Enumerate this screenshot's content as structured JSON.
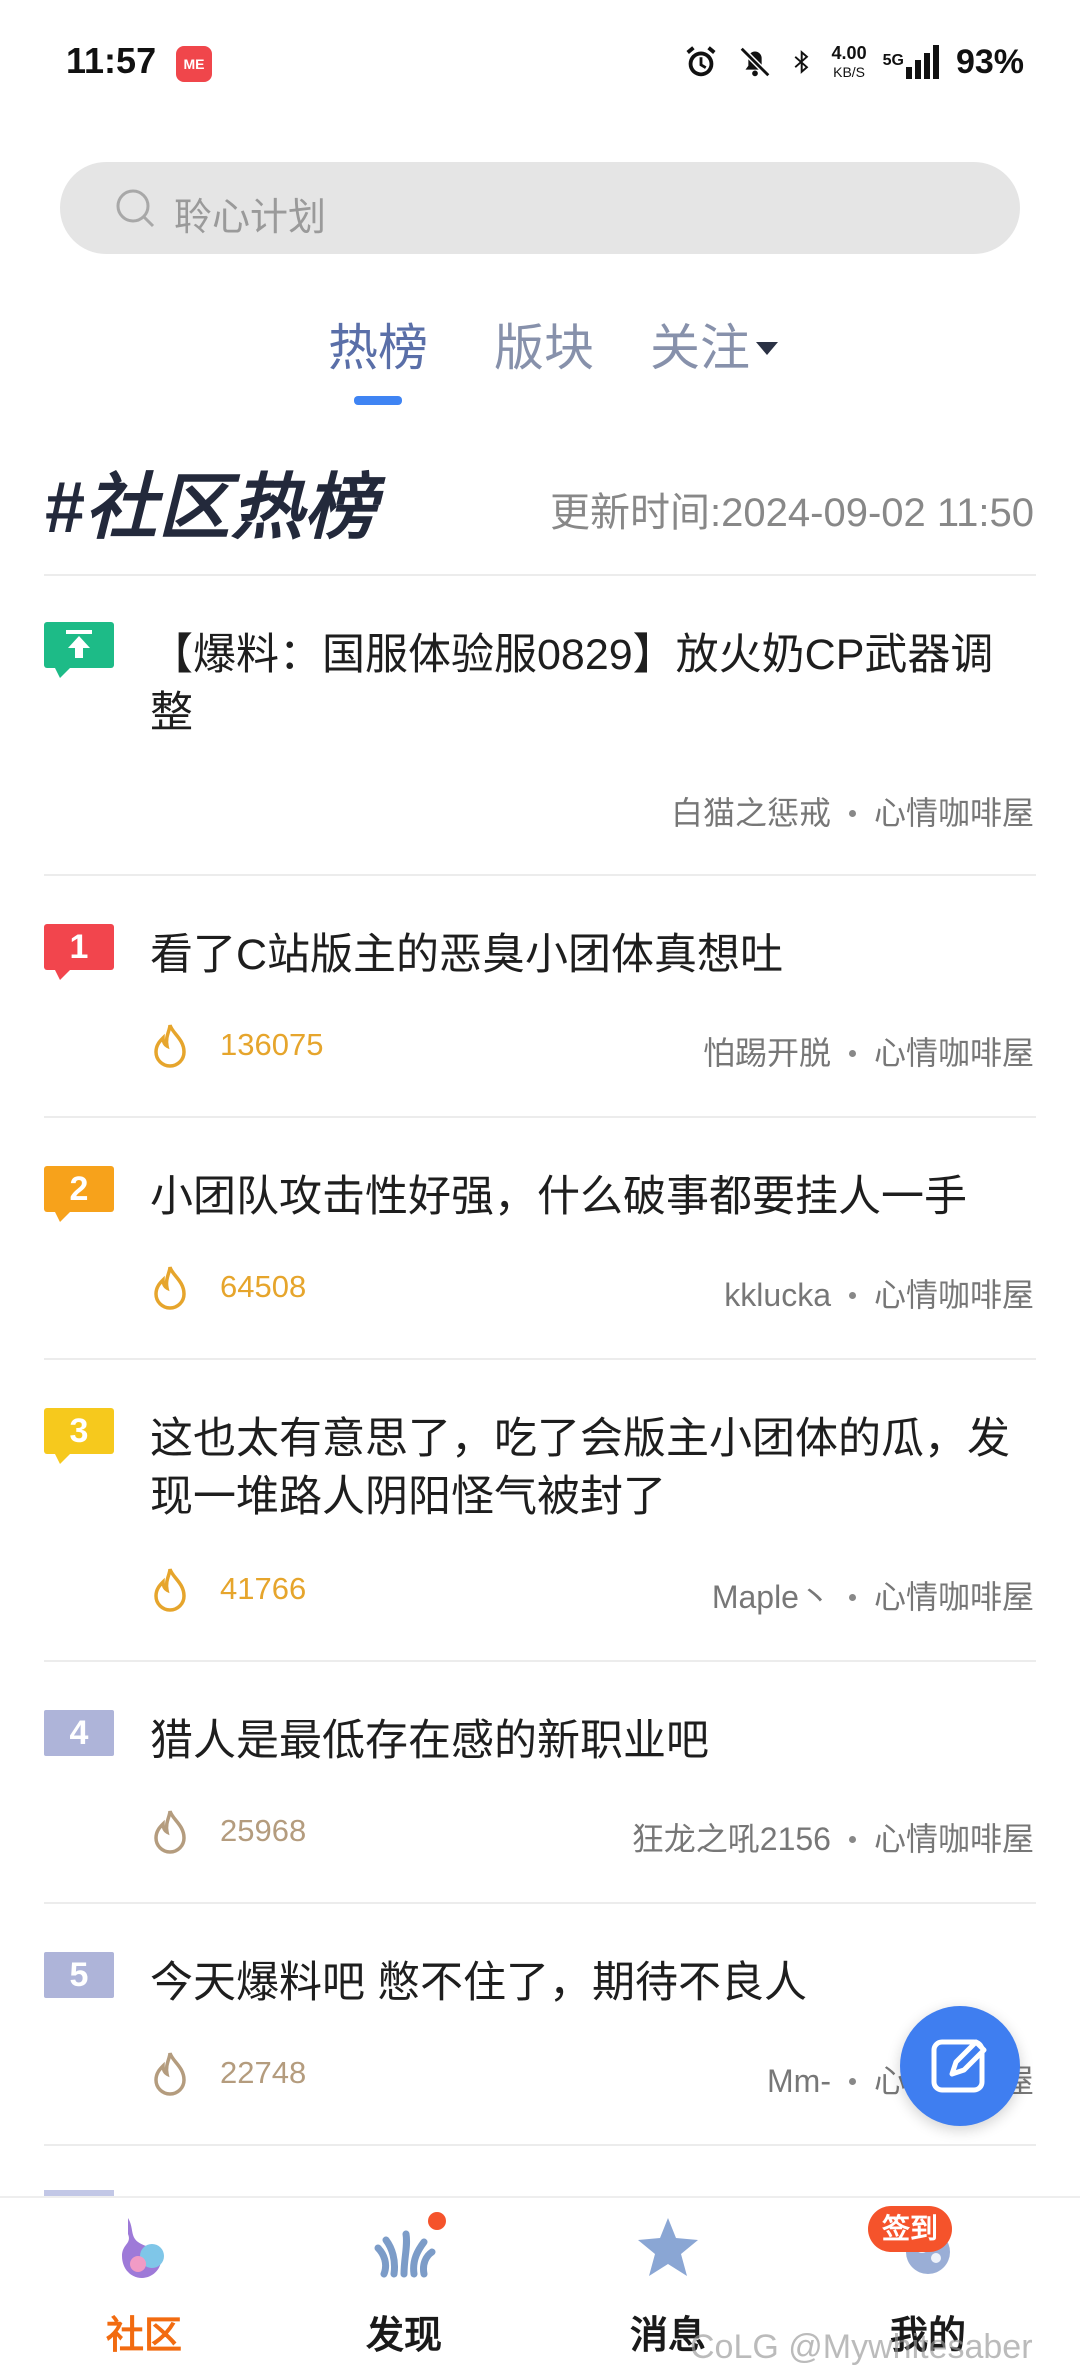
{
  "status_bar": {
    "time": "11:57",
    "app_badge": "ME",
    "net_speed_value": "4.00",
    "net_speed_unit": "KB/S",
    "network": "5G",
    "battery": "93%"
  },
  "search": {
    "placeholder": "聆心计划"
  },
  "tabs": [
    {
      "label": "热榜",
      "active": true
    },
    {
      "label": "版块",
      "active": false
    },
    {
      "label": "关注",
      "active": false
    }
  ],
  "header": {
    "title": "#社区热榜",
    "update_time": "更新时间:2024-09-02 11:50"
  },
  "posts": [
    {
      "rank_type": "pinned",
      "title": "【爆料：国服体验服0829】放火奶CP武器调整",
      "heat": "",
      "author": "白猫之惩戒",
      "board": "心情咖啡屋"
    },
    {
      "rank": "1",
      "title": "看了C站版主的恶臭小团体真想吐",
      "heat": "136075",
      "author": "怕踢开脱",
      "board": "心情咖啡屋"
    },
    {
      "rank": "2",
      "title": "小团队攻击性好强，什么破事都要挂人一手",
      "heat": "64508",
      "author": "kklucka",
      "board": "心情咖啡屋"
    },
    {
      "rank": "3",
      "title": "这也太有意思了，吃了会版主小团体的瓜，发现一堆路人阴阳怪气被封了",
      "heat": "41766",
      "author": "Maple丶",
      "board": "心情咖啡屋"
    },
    {
      "rank": "4",
      "title": "猎人是最低存在感的新职业吧",
      "heat": "25968",
      "author": "狂龙之吼2156",
      "board": "心情咖啡屋"
    },
    {
      "rank": "5",
      "title": "今天爆料吧 憋不住了，期待不良人",
      "heat": "22748",
      "author": "Mm-",
      "board": "心情咖啡屋"
    }
  ],
  "colors": {
    "rank1": "#f2454d",
    "rank2": "#f7a21b",
    "rank3": "#f6c91d",
    "rank_other": "#aeb4d9",
    "pinned": "#1dbb87",
    "heat_hot": "#e6a52c",
    "heat_mild": "#b49c7e",
    "accent": "#f26b10"
  },
  "bottom_nav": [
    {
      "label": "社区",
      "icon": "community-icon",
      "active": true
    },
    {
      "label": "发现",
      "icon": "discover-icon",
      "active": false
    },
    {
      "label": "消息",
      "icon": "message-icon",
      "active": false
    },
    {
      "label": "我的",
      "icon": "profile-icon",
      "active": false
    }
  ],
  "signin_badge": "签到",
  "watermark": "CoLG @Mywhitesaber"
}
